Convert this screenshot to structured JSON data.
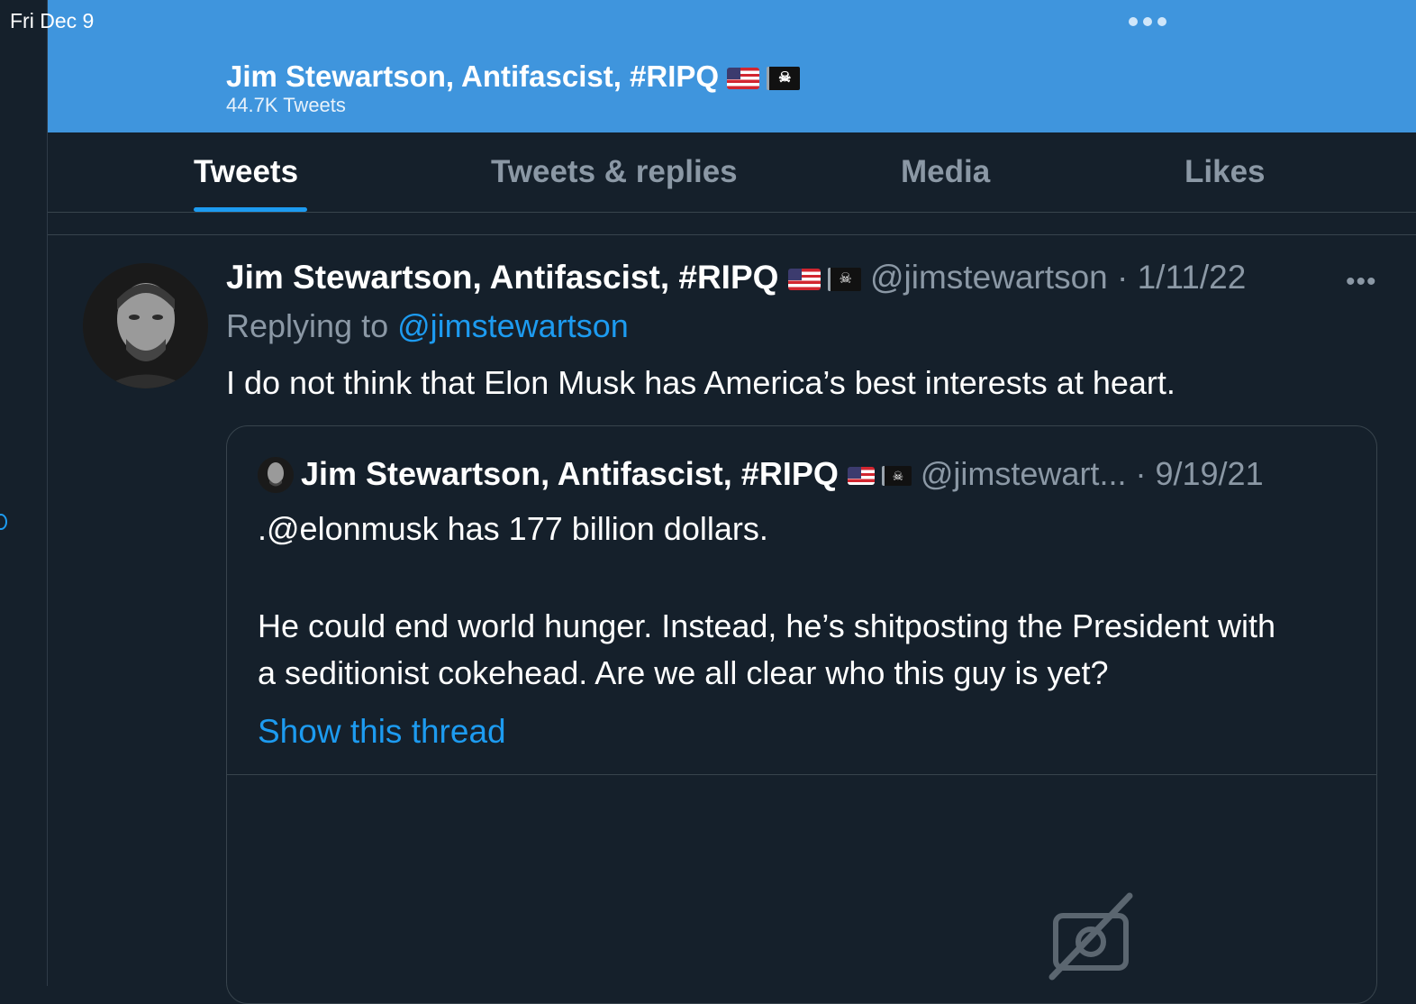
{
  "status_bar": {
    "time": "Fri Dec 9"
  },
  "header": {
    "name": "Jim Stewartson, Antifascist, #RIPQ",
    "tweet_count": "44.7K Tweets"
  },
  "tabs": [
    {
      "label": "Tweets",
      "active": true
    },
    {
      "label": "Tweets & replies",
      "active": false
    },
    {
      "label": "Media",
      "active": false
    },
    {
      "label": "Likes",
      "active": false
    }
  ],
  "tweet": {
    "author": "Jim Stewartson, Antifascist, #RIPQ",
    "handle": "@jimstewartson",
    "separator": "·",
    "date": "1/11/22",
    "replying_prefix": "Replying to",
    "replying_handle": "@jimstewartson",
    "text": "I do not think that Elon Musk has America’s best interests at heart."
  },
  "quote": {
    "author": "Jim Stewartson, Antifascist, #RIPQ",
    "handle": "@jimstewart...",
    "separator": "·",
    "date": "9/19/21",
    "text_line1": ".@elonmusk has 177 billion dollars.",
    "text_line2": "He could end world hunger. Instead, he’s shitposting the President with",
    "text_line3": "a seditionist cokehead. Are we all clear who this guy is yet?",
    "show_thread": "Show this thread"
  },
  "icons": {
    "more": "more-horizontal-icon",
    "media_unavailable": "camera-off-icon",
    "flag1": "us-flag-icon",
    "flag2": "pirate-flag-icon"
  },
  "colors": {
    "header_bg": "#3f95dd",
    "bg": "#15202b",
    "accent": "#1d9bf0",
    "muted": "#8b98a5"
  }
}
